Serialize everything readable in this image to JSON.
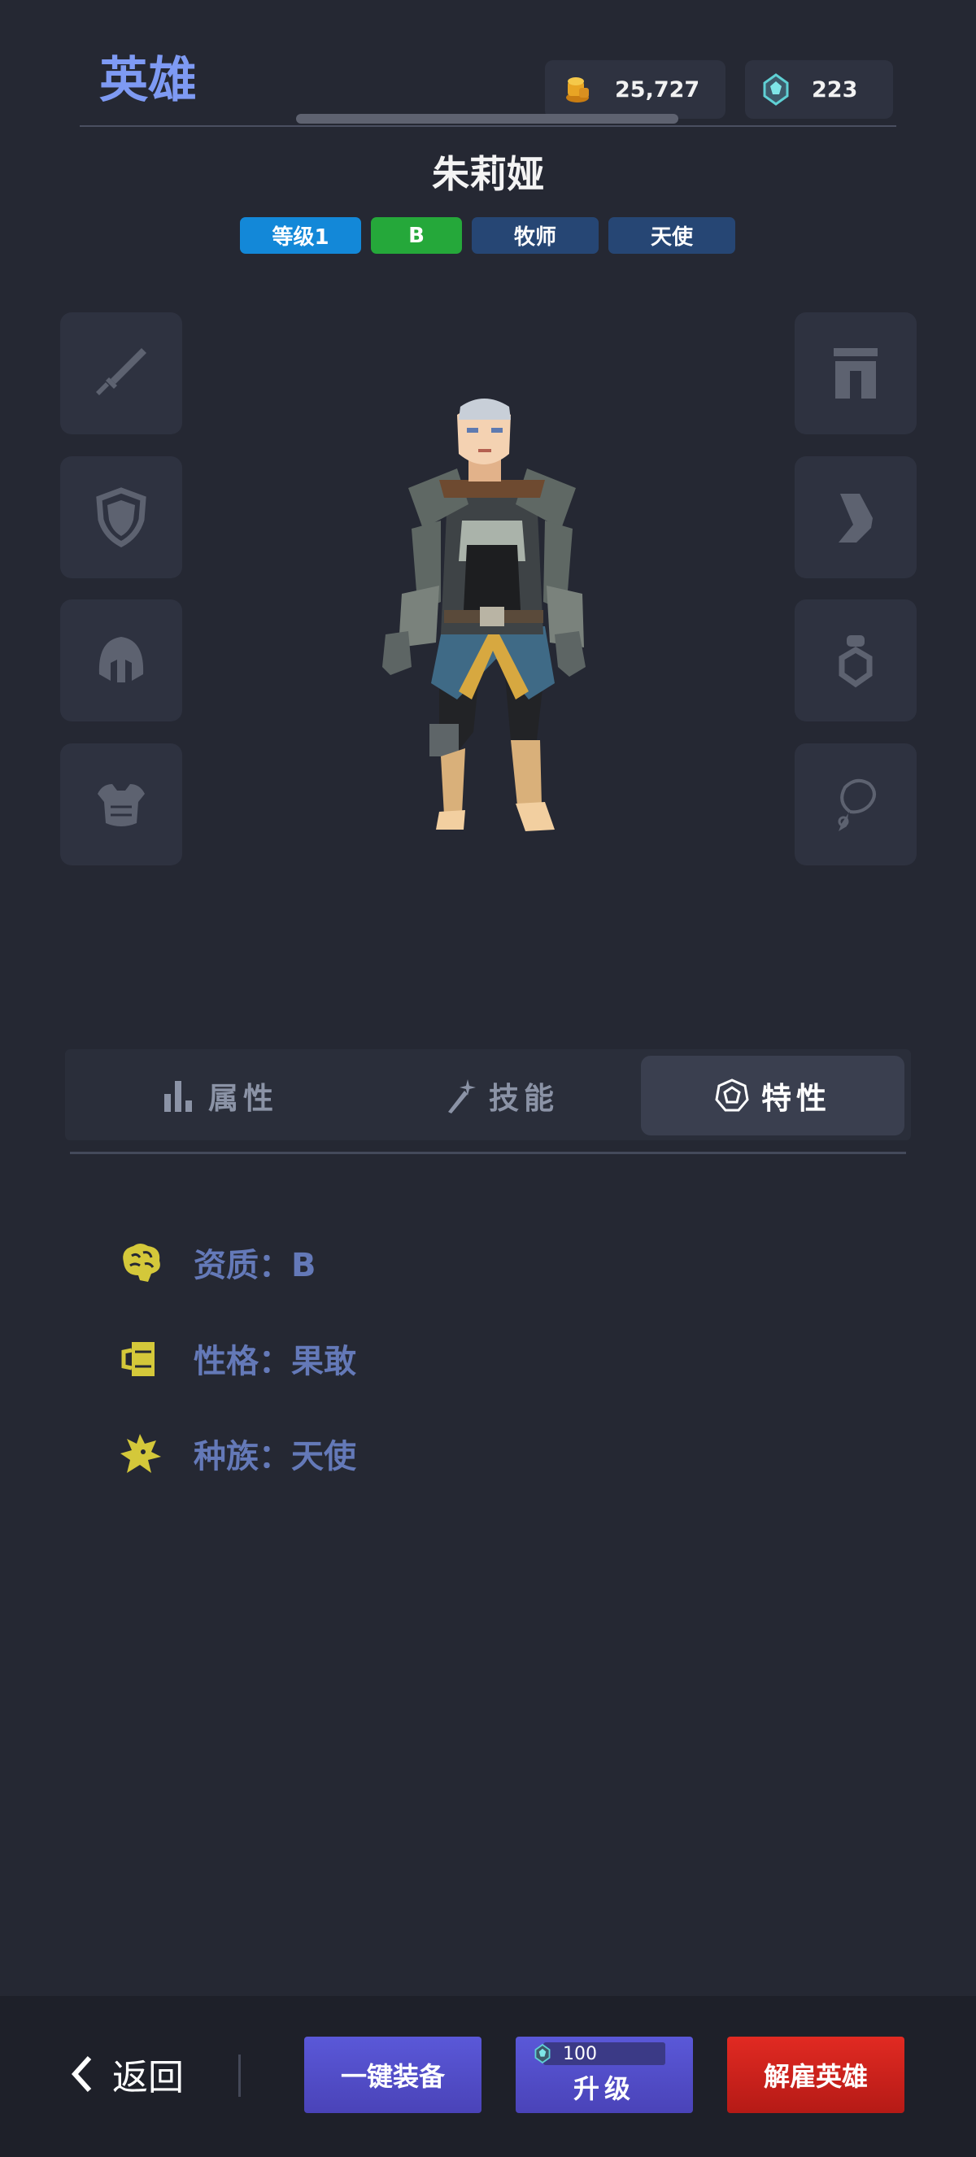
{
  "header": {
    "title": "英雄",
    "gold": "25,727",
    "gems": "223"
  },
  "hero": {
    "name": "朱莉娅",
    "tags": {
      "level": "等级1",
      "grade": "B",
      "class": "牧师",
      "race": "天使"
    }
  },
  "equipment_slots": {
    "left": [
      "sword-icon",
      "shield-icon",
      "helmet-icon",
      "armor-icon"
    ],
    "right": [
      "pants-icon",
      "boots-icon",
      "ring-icon",
      "necklace-icon"
    ]
  },
  "tabs": [
    {
      "label": "属性",
      "icon": "bar-chart-icon",
      "active": false
    },
    {
      "label": "技能",
      "icon": "magic-wand-icon",
      "active": false
    },
    {
      "label": "特性",
      "icon": "trait-badge-icon",
      "active": true
    }
  ],
  "traits": [
    {
      "icon": "brain-icon",
      "text": "资质：B"
    },
    {
      "icon": "mug-icon",
      "text": "性格：果敢"
    },
    {
      "icon": "dragon-icon",
      "text": "种族：天使"
    }
  ],
  "bottom": {
    "back": "返回",
    "equip_all": "一键装备",
    "upgrade_cost": "100",
    "upgrade": "升级",
    "fire": "解雇英雄"
  },
  "colors": {
    "background": "#252833",
    "accent_title": "#7e9af3",
    "trait_icon": "#d4c83a",
    "trait_text": "#6479b8",
    "primary_button": "#5048c8",
    "danger_button": "#c8201a"
  }
}
